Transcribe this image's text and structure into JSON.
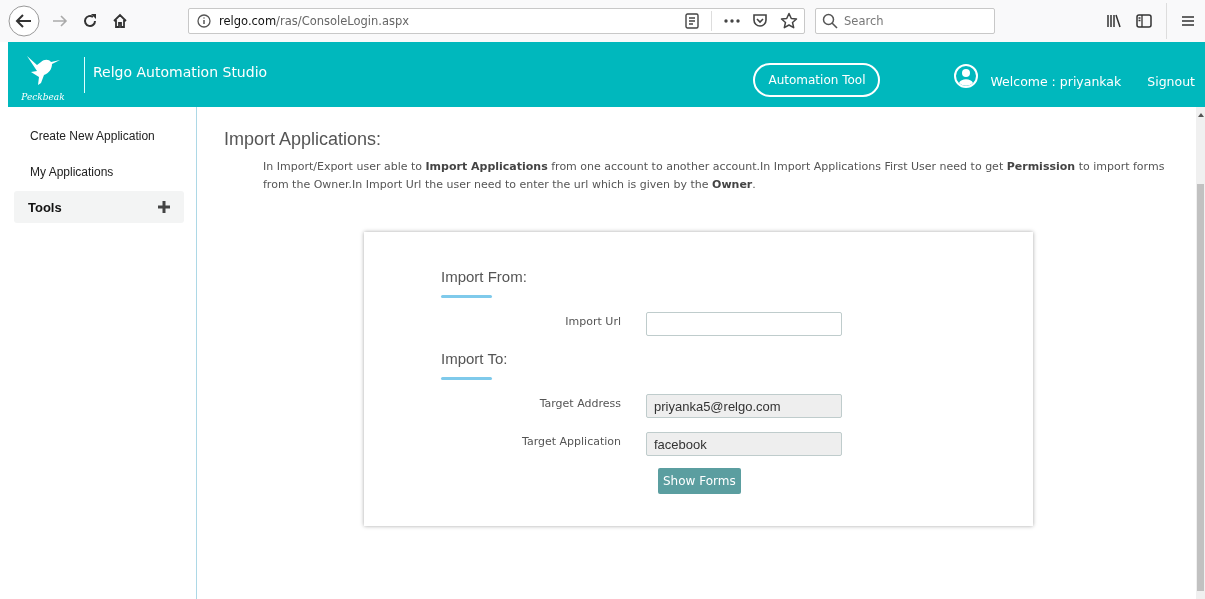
{
  "browser": {
    "url_host": "relgo.com",
    "url_path": "/ras/ConsoleLogin.aspx",
    "search": {
      "placeholder": "Search"
    }
  },
  "header": {
    "logo_text": "Peckbeak",
    "title": "Relgo Automation Studio",
    "tool_button": "Automation Tool",
    "welcome": "Welcome : priyankak",
    "signout": "Signout"
  },
  "sidebar": {
    "items": [
      {
        "label": "Create New Application",
        "kind": "link"
      },
      {
        "label": "My Applications",
        "kind": "link"
      },
      {
        "label": "Tools",
        "kind": "group",
        "expanded": false
      }
    ]
  },
  "content": {
    "title": "Import Applications:",
    "description": "In Import/Export user able to **Import Applications** from one account to another account.In Import Applications First User need to get **Permission** to import forms from the Owner.In Import Url the user need to enter the url which is given by the **Owner**.",
    "sections": [
      {
        "heading": "Import From:",
        "fields": [
          {
            "label": "Import Url",
            "disabled": false
          }
        ]
      },
      {
        "heading": "Import To:",
        "fields": [
          {
            "label": "Target Address",
            "value": "priyanka5@relgo.com",
            "disabled": true
          },
          {
            "label": "Target Application",
            "value": "facebook",
            "disabled": true
          }
        ]
      }
    ],
    "button": "Show Forms"
  }
}
